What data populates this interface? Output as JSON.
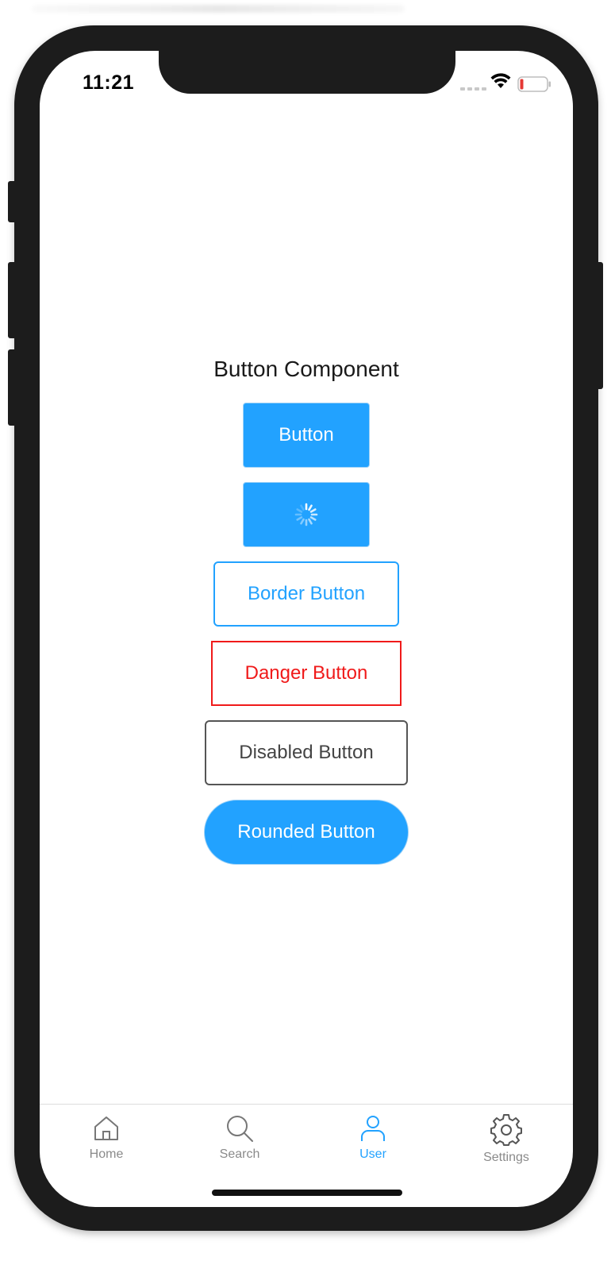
{
  "status_bar": {
    "time": "11:21",
    "icons": [
      "signal-dots-icon",
      "wifi-icon",
      "battery-low-icon"
    ]
  },
  "main": {
    "title": "Button Component",
    "buttons": {
      "primary": "Button",
      "loading": "loading-spinner-icon",
      "border": "Border Button",
      "danger": "Danger Button",
      "disabled": "Disabled Button",
      "rounded": "Rounded Button"
    }
  },
  "tabbar": {
    "items": [
      {
        "label": "Home",
        "icon": "home-icon"
      },
      {
        "label": "Search",
        "icon": "search-icon"
      },
      {
        "label": "User",
        "icon": "user-icon",
        "active": true
      },
      {
        "label": "Settings",
        "icon": "gear-icon"
      }
    ]
  },
  "colors": {
    "accent": "#22a2ff",
    "danger": "#f01a1a",
    "disabled": "#555555",
    "battery_low": "#e53935"
  }
}
